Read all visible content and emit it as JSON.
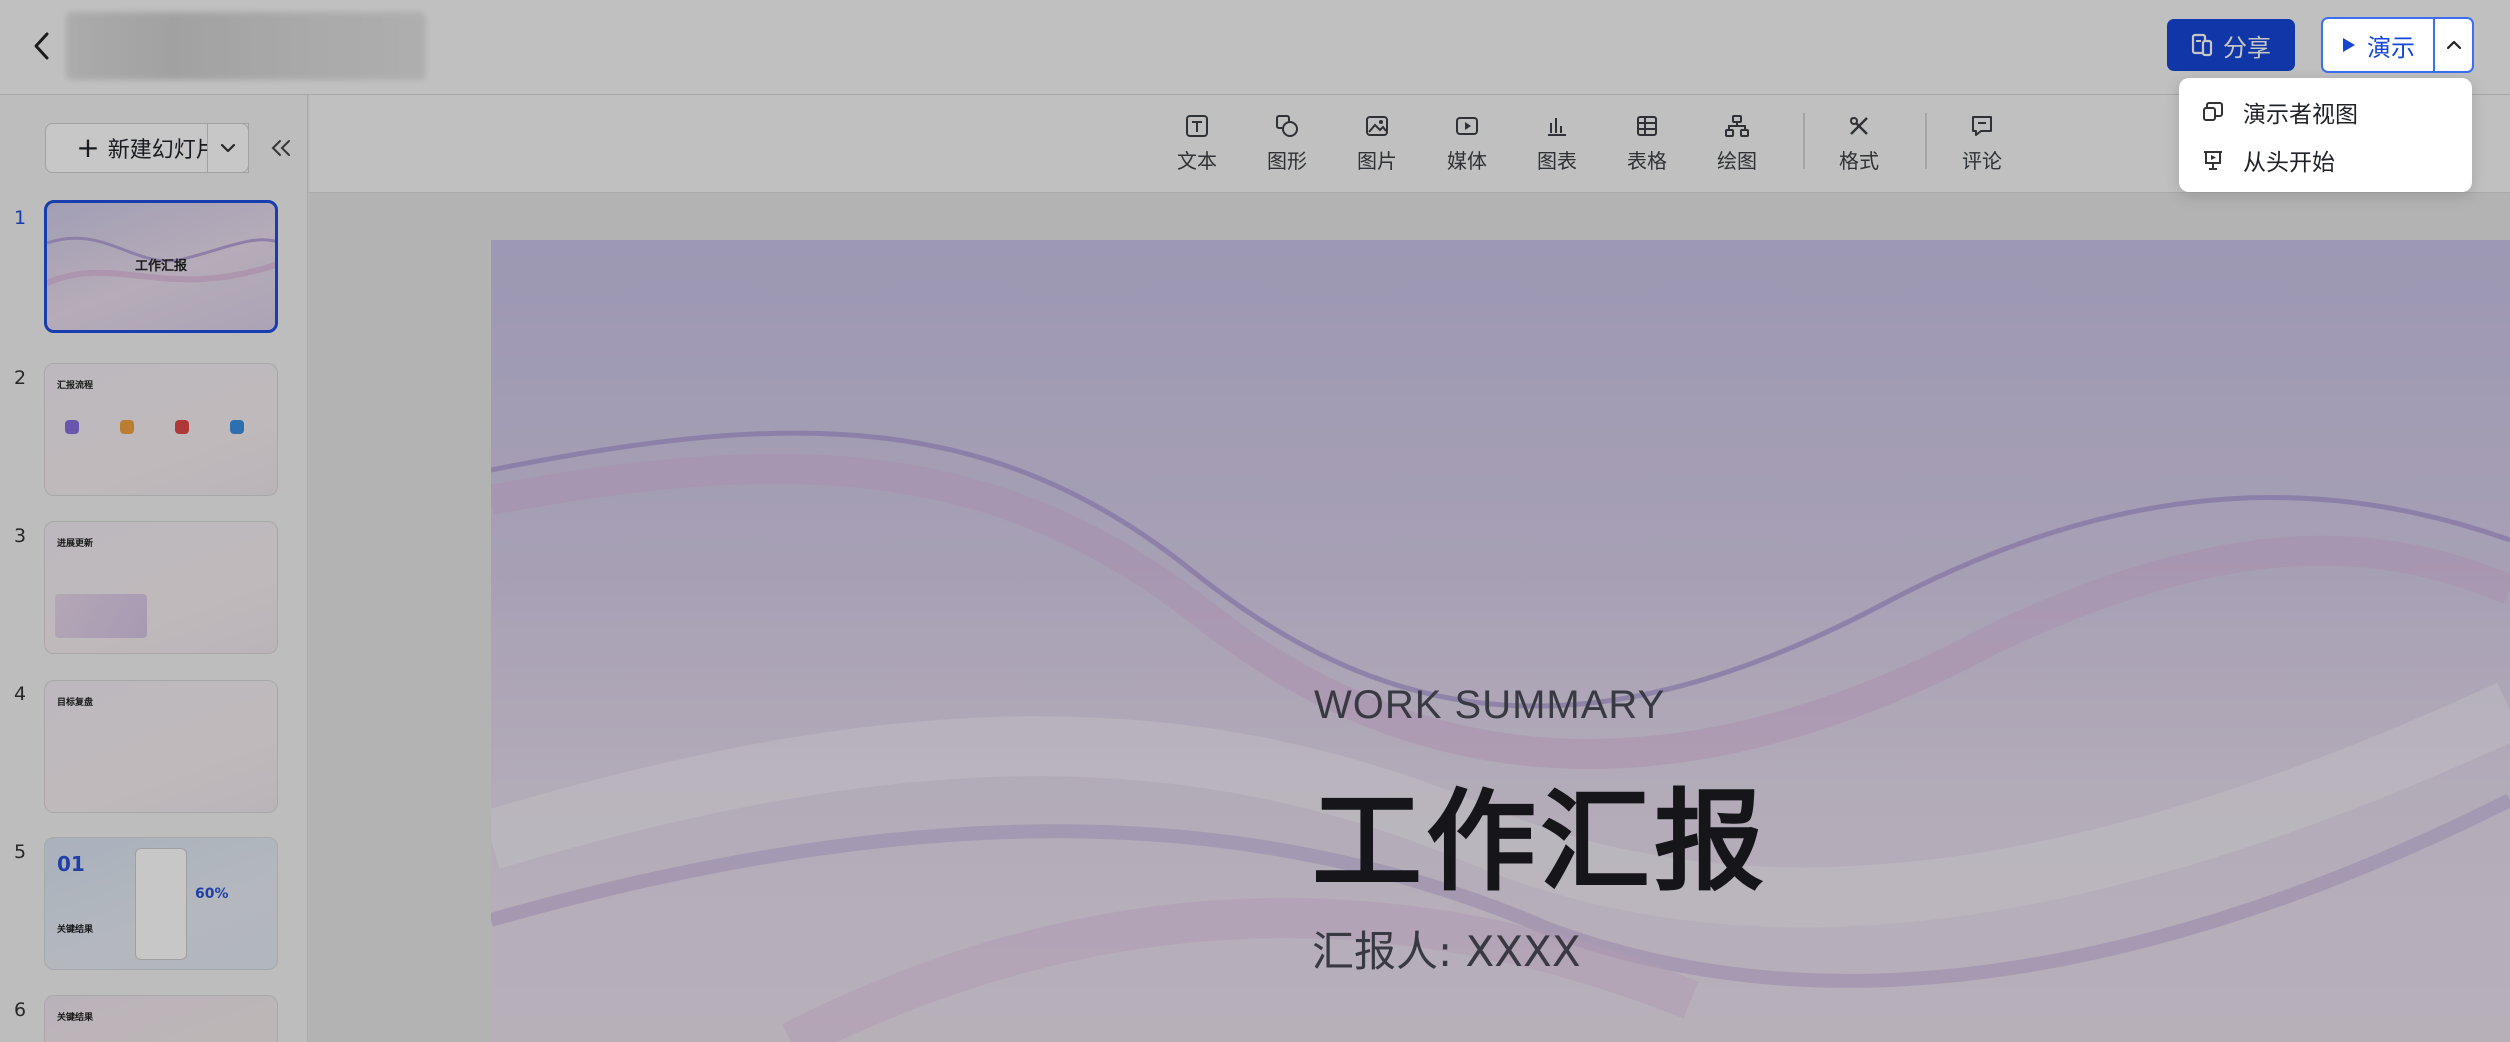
{
  "header": {
    "share_label": "分享",
    "present_label": "演示",
    "dropdown": [
      {
        "label": "演示者视图",
        "icon": "presenter-view-icon"
      },
      {
        "label": "从头开始",
        "icon": "start-from-beginning-icon"
      }
    ]
  },
  "sidebar": {
    "new_slide_label": "新建幻灯片",
    "slides": [
      {
        "number": "1"
      },
      {
        "number": "2"
      },
      {
        "number": "3"
      },
      {
        "number": "4"
      },
      {
        "number": "5"
      },
      {
        "number": "6"
      }
    ],
    "thumb1_title": "工作汇报",
    "thumb2_title": "汇报流程",
    "thumb3_title": "进展更新",
    "thumb4_title": "目标复盘",
    "thumb5_num": "01",
    "thumb5_label": "关键结果",
    "thumb5_pct": "60%",
    "thumb6_title": "关键结果"
  },
  "toolbar": {
    "tools": [
      {
        "label": "文本",
        "icon": "text-icon"
      },
      {
        "label": "图形",
        "icon": "shape-icon"
      },
      {
        "label": "图片",
        "icon": "image-icon"
      },
      {
        "label": "媒体",
        "icon": "media-icon"
      },
      {
        "label": "图表",
        "icon": "chart-icon"
      },
      {
        "label": "表格",
        "icon": "table-icon"
      },
      {
        "label": "绘图",
        "icon": "diagram-icon"
      },
      {
        "label": "格式",
        "icon": "format-icon"
      },
      {
        "label": "评论",
        "icon": "comment-icon"
      }
    ]
  },
  "slide": {
    "subtitle": "WORK SUMMARY",
    "title": "工作汇报",
    "reporter": "汇报人: XXXX"
  },
  "colors": {
    "accent": "#1546d6",
    "active_border": "#1e4fe0"
  }
}
